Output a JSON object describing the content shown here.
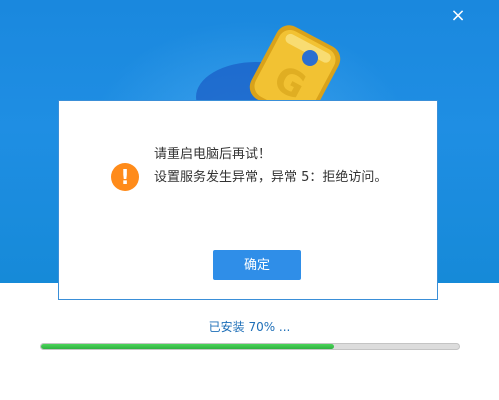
{
  "window": {
    "close_glyph": "×"
  },
  "dialog": {
    "icon": "warning-icon",
    "icon_glyph": "!",
    "line1": "请重启电脑后再试！",
    "line2": "设置服务发生异常，异常 5：拒绝访问。",
    "ok_label": "确定"
  },
  "install": {
    "status_text": "已安装 70% ...",
    "progress_fraction": 0.7
  },
  "colors": {
    "banner_blue": "#1f8ee3",
    "button_blue": "#2f8ee8",
    "warning_orange": "#ff8b1a",
    "progress_green": "#2fb240",
    "status_text": "#1e6fb8"
  }
}
